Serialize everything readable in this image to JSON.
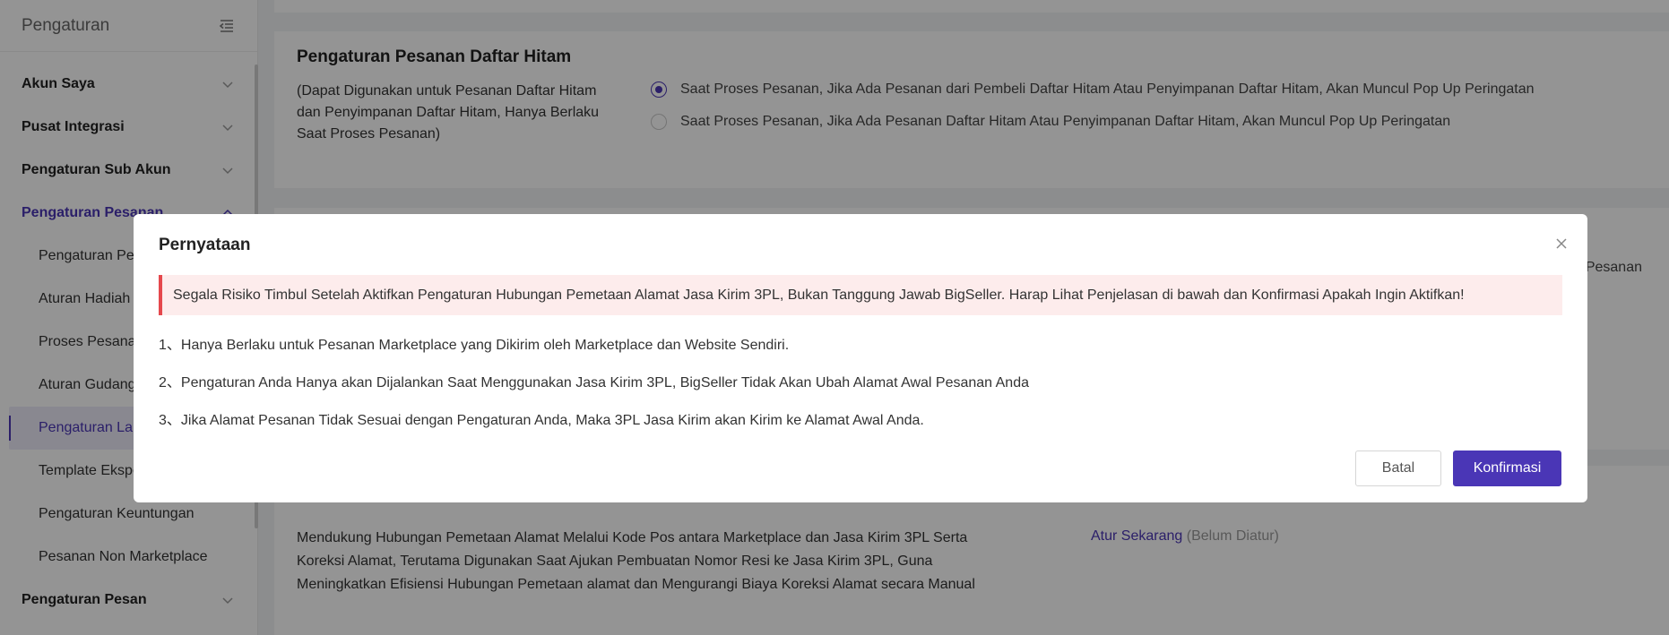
{
  "sidebar": {
    "title": "Pengaturan",
    "groups": [
      {
        "label": "Akun Saya"
      },
      {
        "label": "Pusat Integrasi"
      },
      {
        "label": "Pengaturan Sub Akun"
      },
      {
        "label": "Pengaturan Pesanan"
      }
    ],
    "sub_items": [
      {
        "label": "Pengaturan Pesanan"
      },
      {
        "label": "Aturan Hadiah"
      },
      {
        "label": "Proses Pesanan"
      },
      {
        "label": "Aturan Gudang"
      },
      {
        "label": "Pengaturan Label"
      },
      {
        "label": "Template Ekspor"
      },
      {
        "label": "Pengaturan Keuntungan"
      },
      {
        "label": "Pesanan Non Marketplace"
      }
    ],
    "last_group": {
      "label": "Pengaturan Pesan"
    }
  },
  "blacklist": {
    "title": "Pengaturan Pesanan Daftar Hitam",
    "description": "(Dapat Digunakan untuk Pesanan Daftar Hitam dan Penyimpanan Daftar Hitam, Hanya Berlaku Saat Proses Pesanan)",
    "options": [
      {
        "label": "Saat Proses Pesanan, Jika Ada Pesanan dari Pembeli Daftar Hitam Atau Penyimpanan Daftar Hitam, Akan Muncul Pop Up Peringatan",
        "selected": true
      },
      {
        "label": "Saat Proses Pesanan, Jika Ada Pesanan Daftar Hitam Atau Penyimpanan Daftar Hitam, Akan Muncul Pop Up Peringatan",
        "selected": false
      }
    ]
  },
  "card2": {
    "right_text": "Pesanan"
  },
  "address_mapping": {
    "description": "Mendukung Hubungan Pemetaan Alamat Melalui Kode Pos antara Marketplace dan Jasa Kirim 3PL Serta Koreksi Alamat, Terutama Digunakan Saat Ajukan Pembuatan Nomor Resi ke Jasa Kirim 3PL, Guna Meningkatkan Efisiensi Hubungan Pemetaan alamat dan Mengurangi Biaya Koreksi Alamat secara Manual",
    "action_link": "Atur Sekarang",
    "status": "(Belum Diatur)"
  },
  "modal": {
    "title": "Pernyataan",
    "alert": "Segala Risiko Timbul Setelah Aktifkan Pengaturan Hubungan Pemetaan Alamat Jasa Kirim 3PL, Bukan Tanggung Jawab BigSeller. Harap Lihat Penjelasan di bawah dan Konfirmasi Apakah Ingin Aktifkan!",
    "notes": [
      "1、Hanya Berlaku untuk Pesanan Marketplace yang Dikirim oleh Marketplace dan Website Sendiri.",
      "2、Pengaturan Anda Hanya akan Dijalankan Saat Menggunakan Jasa Kirim 3PL, BigSeller Tidak Akan Ubah Alamat Awal Pesanan Anda",
      "3、Jika Alamat Pesanan Tidak Sesuai dengan Pengaturan Anda, Maka 3PL Jasa Kirim akan Kirim ke Alamat Awal Anda."
    ],
    "cancel_label": "Batal",
    "confirm_label": "Konfirmasi"
  },
  "colors": {
    "accent": "#4a36b6",
    "alert_border": "#e5484d",
    "alert_bg": "#fdecec"
  }
}
